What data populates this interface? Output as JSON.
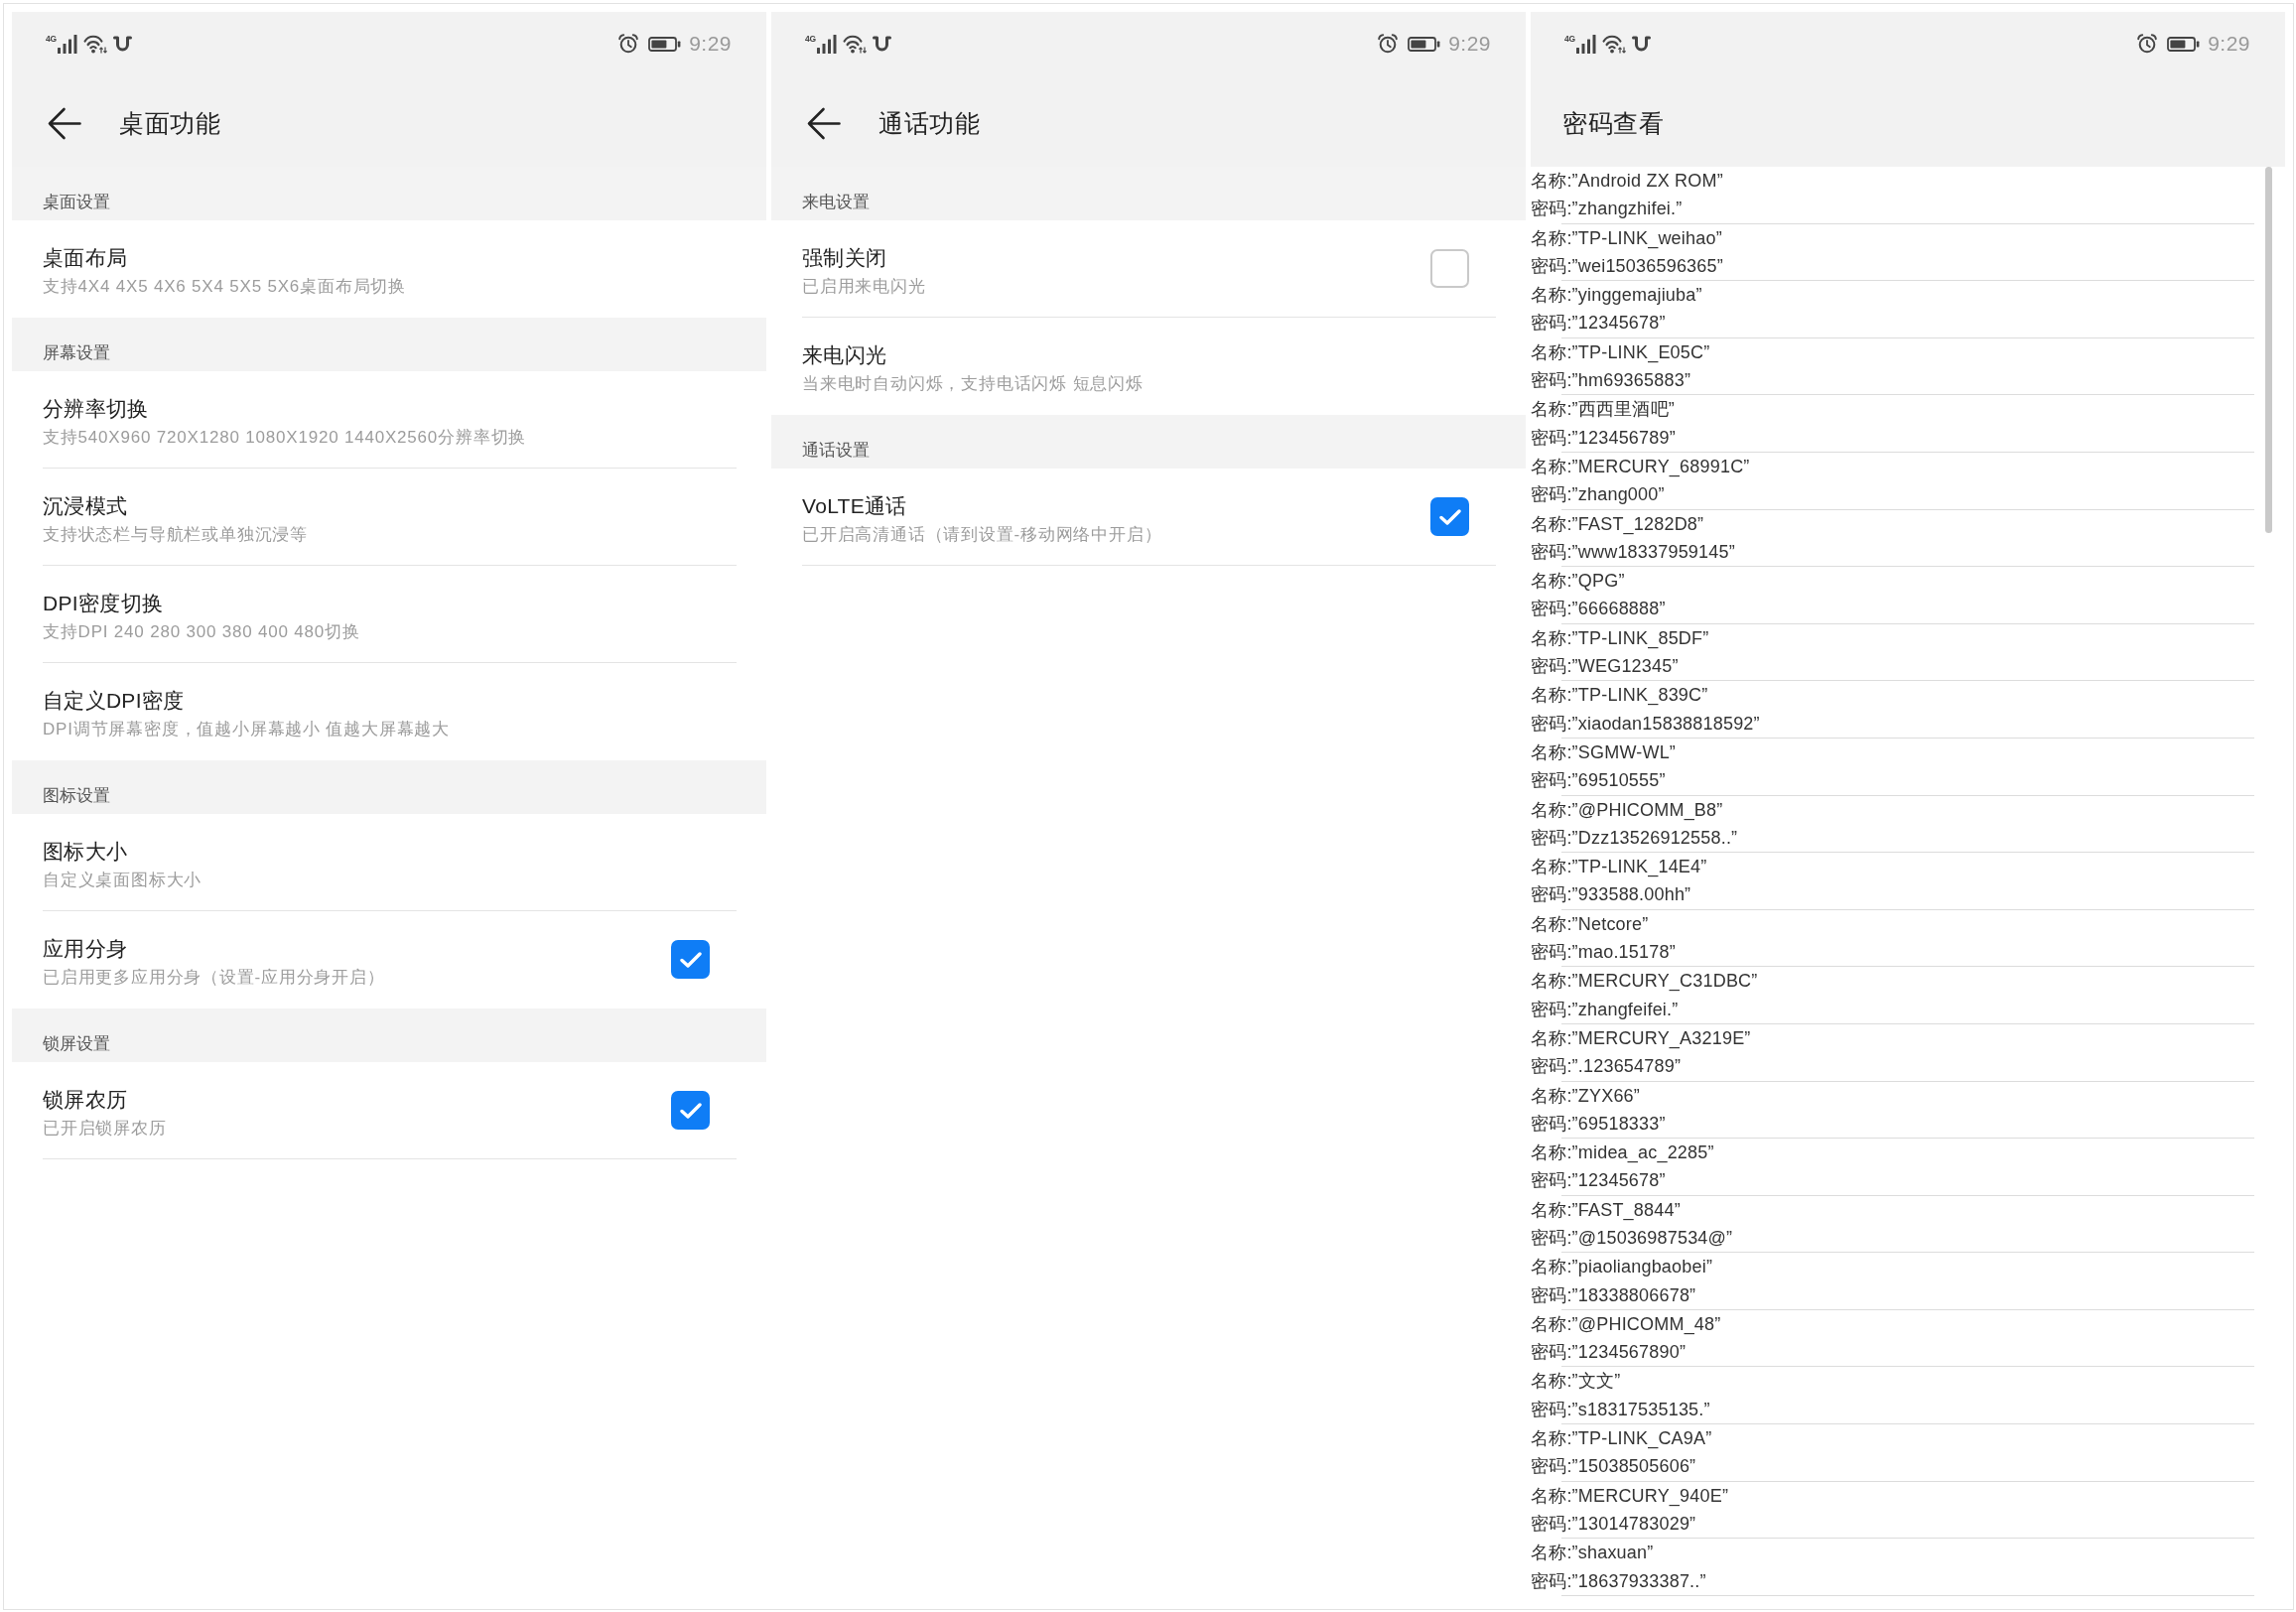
{
  "panels": [
    {
      "kind": "settings",
      "status_bar": {
        "network": "4G",
        "time": "9:29"
      },
      "header": {
        "title": "桌面功能",
        "back_button": true
      },
      "sections": [
        {
          "title": "桌面设置",
          "items": [
            {
              "kind": "plain",
              "title": "桌面布局",
              "subtitle": "支持4X4 4X5 4X6 5X4 5X5 5X6桌面布局切换"
            }
          ]
        },
        {
          "title": "屏幕设置",
          "items": [
            {
              "kind": "plain",
              "title": "分辨率切换",
              "subtitle": "支持540X960 720X1280 1080X1920 1440X2560分辨率切换"
            },
            {
              "kind": "plain",
              "title": "沉浸模式",
              "subtitle": "支持状态栏与导航栏或单独沉浸等"
            },
            {
              "kind": "plain",
              "title": "DPI密度切换",
              "subtitle": "支持DPI 240 280 300 380 400 480切换"
            },
            {
              "kind": "plain",
              "title": "自定义DPI密度",
              "subtitle": "DPI调节屏幕密度，值越小屏幕越小 值越大屏幕越大"
            }
          ]
        },
        {
          "title": "图标设置",
          "items": [
            {
              "kind": "plain",
              "title": "图标大小",
              "subtitle": "自定义桌面图标大小"
            },
            {
              "kind": "checkbox",
              "title": "应用分身",
              "subtitle": "已启用更多应用分身（设置-应用分身开启）",
              "checked": true
            }
          ]
        },
        {
          "title": "锁屏设置",
          "items": [
            {
              "kind": "checkbox",
              "title": "锁屏农历",
              "subtitle": "已开启锁屏农历",
              "checked": true
            }
          ]
        }
      ]
    },
    {
      "kind": "settings",
      "status_bar": {
        "network": "4G",
        "time": "9:29"
      },
      "header": {
        "title": "通话功能",
        "back_button": true
      },
      "sections": [
        {
          "title": "来电设置",
          "items": [
            {
              "kind": "checkbox",
              "title": "强制关闭",
              "subtitle": "已启用来电闪光",
              "checked": false
            },
            {
              "kind": "plain",
              "title": "来电闪光",
              "subtitle": "当来电时自动闪烁，支持电话闪烁 短息闪烁"
            }
          ]
        },
        {
          "title": "通话设置",
          "items": [
            {
              "kind": "checkbox",
              "title": "VoLTE通话",
              "subtitle": "已开启高清通话（请到设置-移动网络中开启）",
              "checked": true
            }
          ]
        }
      ]
    },
    {
      "kind": "list",
      "status_bar": {
        "network": "4G",
        "time": "9:29"
      },
      "header": {
        "title": "密码查看",
        "back_button": false
      },
      "entries": [
        {
          "name": "名称:”Android ZX ROM”",
          "password": "密码:”zhangzhifei.”"
        },
        {
          "name": "名称:”TP-LINK_weihao”",
          "password": "密码:”wei15036596365”"
        },
        {
          "name": "名称:”yinggemajiuba”",
          "password": "密码:”12345678”"
        },
        {
          "name": "名称:”TP-LINK_E05C”",
          "password": "密码:”hm69365883”"
        },
        {
          "name": "名称:”西西里酒吧”",
          "password": "密码:”123456789”"
        },
        {
          "name": "名称:”MERCURY_68991C”",
          "password": "密码:”zhang000”"
        },
        {
          "name": "名称:”FAST_1282D8”",
          "password": "密码:”www18337959145”"
        },
        {
          "name": "名称:”QPG”",
          "password": "密码:”66668888”"
        },
        {
          "name": "名称:”TP-LINK_85DF”",
          "password": "密码:”WEG12345”"
        },
        {
          "name": "名称:”TP-LINK_839C”",
          "password": "密码:”xiaodan15838818592”"
        },
        {
          "name": "名称:”SGMW-WL”",
          "password": "密码:”69510555”"
        },
        {
          "name": "名称:”@PHICOMM_B8”",
          "password": "密码:”Dzz13526912558..”"
        },
        {
          "name": "名称:”TP-LINK_14E4”",
          "password": "密码:”933588.00hh”"
        },
        {
          "name": "名称:”Netcore”",
          "password": "密码:”mao.15178”"
        },
        {
          "name": "名称:”MERCURY_C31DBC”",
          "password": "密码:”zhangfeifei.”"
        },
        {
          "name": "名称:”MERCURY_A3219E”",
          "password": "密码:”.123654789”"
        },
        {
          "name": "名称:”ZYX66”",
          "password": "密码:”69518333”"
        },
        {
          "name": "名称:”midea_ac_2285”",
          "password": "密码:”12345678”"
        },
        {
          "name": "名称:”FAST_8844”",
          "password": "密码:”@15036987534@”"
        },
        {
          "name": "名称:”piaoliangbaobei”",
          "password": "密码:”18338806678”"
        },
        {
          "name": "名称:”@PHICOMM_48”",
          "password": "密码:”1234567890”"
        },
        {
          "name": "名称:”文文”",
          "password": "密码:”s18317535135.”"
        },
        {
          "name": "名称:”TP-LINK_CA9A”",
          "password": "密码:”15038505606”"
        },
        {
          "name": "名称:”MERCURY_940E”",
          "password": "密码:”13014783029”"
        },
        {
          "name": "名称:”shaxuan”",
          "password": "密码:”18637933387..”"
        }
      ]
    }
  ]
}
